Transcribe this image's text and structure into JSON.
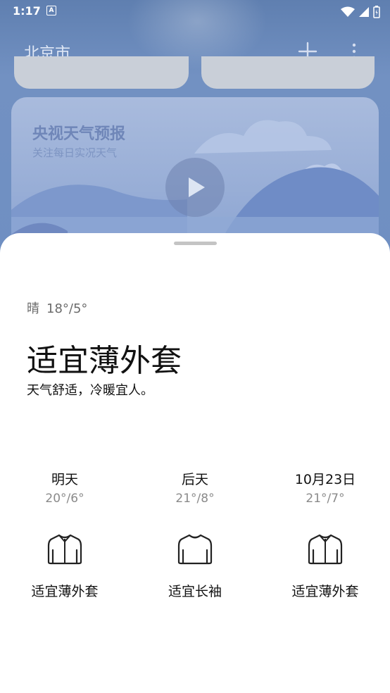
{
  "status": {
    "time": "1:17",
    "notification": "A"
  },
  "app_bar": {
    "city": "北京市",
    "add_icon": "plus-icon",
    "more_icon": "more-vertical-icon"
  },
  "video_card": {
    "title": "央视天气预报",
    "subtitle": "关注每日实况天气",
    "play_icon": "play-icon"
  },
  "sheet": {
    "weather": "晴",
    "temp_range": "18°/5°",
    "headline": "适宜薄外套",
    "description": "天气舒适，冷暖宜人。",
    "days": [
      {
        "name": "明天",
        "temp": "20°/6°",
        "icon": "jacket-icon",
        "advice": "适宜薄外套"
      },
      {
        "name": "后天",
        "temp": "21°/8°",
        "icon": "long-sleeve-shirt-icon",
        "advice": "适宜长袖"
      },
      {
        "name": "10月23日",
        "temp": "21°/7°",
        "icon": "jacket-icon",
        "advice": "适宜薄外套"
      }
    ]
  }
}
